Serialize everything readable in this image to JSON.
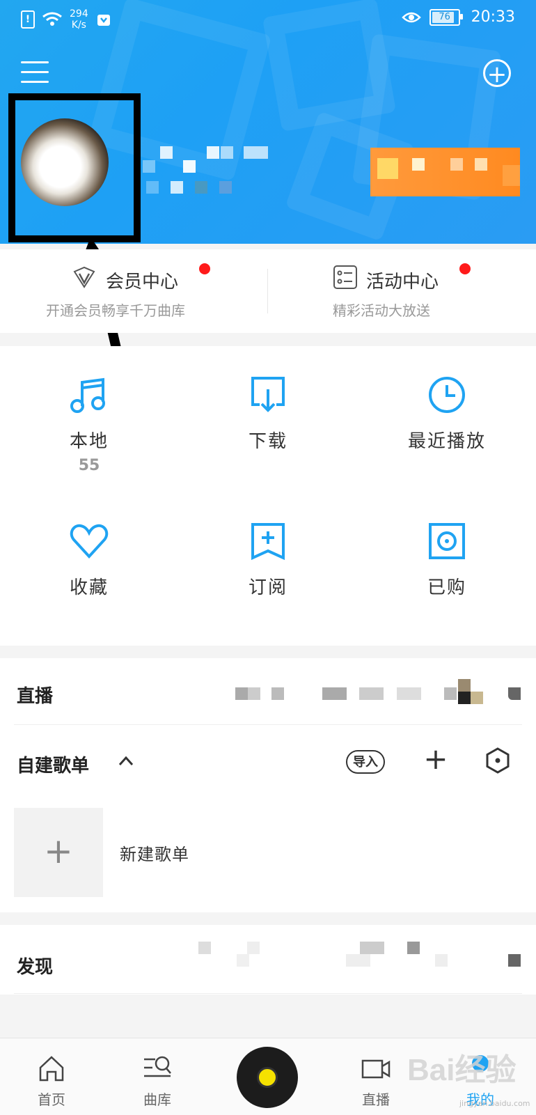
{
  "status_bar": {
    "net_speed_value": "294",
    "net_speed_unit": "K/s",
    "battery": "76",
    "time": "20:33"
  },
  "member_center": {
    "title": "会员中心",
    "subtitle": "开通会员畅享千万曲库"
  },
  "activity_center": {
    "title": "活动中心",
    "subtitle": "精彩活动大放送"
  },
  "grid": [
    {
      "label": "本地",
      "count": "55",
      "icon": "music-note-icon"
    },
    {
      "label": "下载",
      "icon": "download-icon"
    },
    {
      "label": "最近播放",
      "icon": "clock-icon"
    },
    {
      "label": "收藏",
      "icon": "heart-icon"
    },
    {
      "label": "订阅",
      "icon": "bookmark-plus-icon"
    },
    {
      "label": "已购",
      "icon": "purchased-icon"
    }
  ],
  "live": {
    "title": "直播"
  },
  "playlists": {
    "title": "自建歌单",
    "import_label": "导入",
    "new_playlist_label": "新建歌单"
  },
  "discover": {
    "title": "发现"
  },
  "bottom_nav": [
    {
      "label": "首页",
      "icon": "home-icon"
    },
    {
      "label": "曲库",
      "icon": "library-search-icon"
    },
    {
      "label": "直播",
      "icon": "video-camera-icon"
    },
    {
      "label": "我的",
      "icon": "profile-icon"
    }
  ],
  "watermark": {
    "main": "Bai经验",
    "sub": "jingyan.baidu.com"
  },
  "colors": {
    "accent": "#1fa3f2",
    "red_dot": "#ff1a1a",
    "vip": "#ff8a20"
  }
}
